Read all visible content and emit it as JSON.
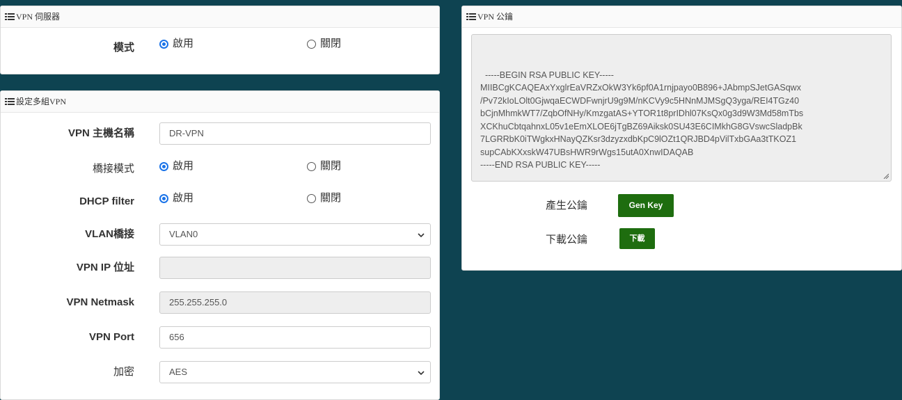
{
  "vpn_server": {
    "title": "VPN 伺服器",
    "mode_label": "模式",
    "enable": "啟用",
    "disable": "關閉"
  },
  "multi_vpn": {
    "title": "設定多組VPN",
    "hostname_label": "VPN 主機名稱",
    "hostname_value": "DR-VPN",
    "bridge_mode_label": "橋接模式",
    "dhcp_filter_label": "DHCP filter",
    "enable": "啟用",
    "disable": "關閉",
    "vlan_label": "VLAN橋接",
    "vlan_value": "VLAN0",
    "ip_label": "VPN IP 位址",
    "ip_value": "",
    "netmask_label": "VPN Netmask",
    "netmask_value": "255.255.255.0",
    "port_label": "VPN Port",
    "port_value": "656",
    "encrypt_label": "加密",
    "encrypt_value": "AES"
  },
  "public_key": {
    "title": "VPN 公鑰",
    "key_text": "-----BEGIN RSA PUBLIC KEY-----\nMIIBCgKCAQEAxYxglrEaVRZxOkW3Yk6pf0A1rnjpayo0B896+JAbmpSJetGASqwx\n/Pv72kIoLOlt0GjwqaECWDFwnjrU9g9M/nKCVy9c5HNnMJMSgQ3yga/REI4TGz40\nbCjnMhmkWT7/ZqbOfNHy/KmzgatAS+YTOR1t8prIDhl07KsQx0g3d9W3Md58mTbs\nXCKhuCbtqahnxL05v1eEmXLOE6jTgBZ69Aiksk0SU43E6CIMkhG8GVswcSladpBk\n7LGRRbK0iTWgkxHNayQZKsr3dzyzxdbKpC9lOZt1QRJBD4pVilTxbGAa3tTKOZ1\nsupCAbKXxskW47UBsHWR9rWgs15utA0XnwIDAQAB\n-----END RSA PUBLIC KEY-----",
    "gen_label": "產生公鑰",
    "gen_button": "Gen Key",
    "download_label": "下載公鑰",
    "download_button": "下載"
  },
  "colors": {
    "background": "#0e4351",
    "accent_green": "#1e6d0f",
    "radio_blue": "#1a73e8"
  }
}
